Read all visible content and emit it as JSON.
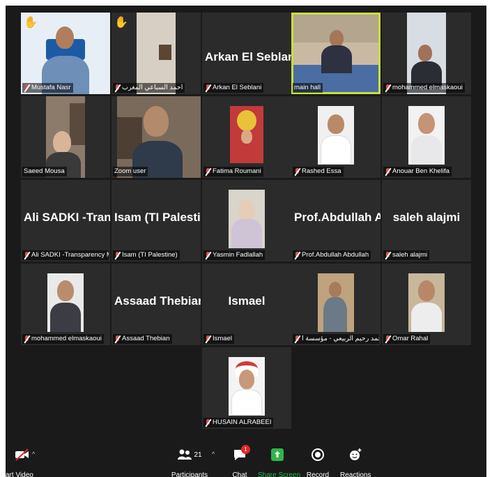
{
  "participants": [
    {
      "name": "Mustafa Nasr",
      "big_name": ""
    },
    {
      "name": "احمد السباعي المغرب",
      "big_name": ""
    },
    {
      "name": "Arkan El Seblani",
      "big_name": "Arkan El Seblani"
    },
    {
      "name": "main hall",
      "big_name": ""
    },
    {
      "name": "mohammed elmaskaoui",
      "big_name": ""
    },
    {
      "name": "Saeed Mousa",
      "big_name": ""
    },
    {
      "name": "Zoom user",
      "big_name": ""
    },
    {
      "name": "Fatima Roumani",
      "big_name": ""
    },
    {
      "name": "Rashed Essa",
      "big_name": ""
    },
    {
      "name": "Anouar Ben Khelifa",
      "big_name": ""
    },
    {
      "name": "Ali SADKI -Transparency Mo...",
      "big_name": "Ali SADKI -Tran..."
    },
    {
      "name": "Isam (TI Palestine)",
      "big_name": "Isam (TI Palesti..."
    },
    {
      "name": "Yasmin Fadlallah",
      "big_name": ""
    },
    {
      "name": "Prof.Abdullah Abdullah",
      "big_name": "Prof.Abdullah A..."
    },
    {
      "name": "saleh alajmi",
      "big_name": "saleh alajmi"
    },
    {
      "name": "mohammed elmaskaoui",
      "big_name": ""
    },
    {
      "name": "Assaad Thebian",
      "big_name": "Assaad Thebian"
    },
    {
      "name": "Ismael",
      "big_name": "Ismael"
    },
    {
      "name": "محمد رحيم الربيعي - مؤسسة ا...",
      "big_name": ""
    },
    {
      "name": "Omar Rahal",
      "big_name": ""
    },
    {
      "name": "HUSAIN ALRABEEI",
      "big_name": ""
    }
  ],
  "toolbar": {
    "video_label": "art Video",
    "participants_label": "Participants",
    "participants_count": "21",
    "chat_label": "Chat",
    "chat_badge": "1",
    "share_label": "Share Screen",
    "record_label": "Record",
    "reactions_label": "Reactions"
  },
  "colors": {
    "background": "#1a1a1a",
    "tile": "#2b2b2b",
    "active_speaker_border": "#c8e03c",
    "share_green": "#2fb54a",
    "mic_off_red": "#d9534f",
    "chat_badge_red": "#e02828"
  },
  "icons": {
    "raised_hand": "raised-hand-icon",
    "mic_muted": "mic-off-icon"
  }
}
